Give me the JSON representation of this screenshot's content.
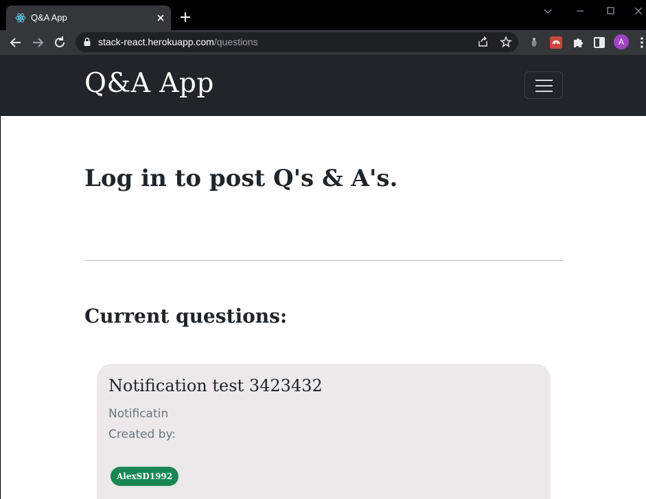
{
  "browser": {
    "tab": {
      "title": "Q&A App"
    },
    "address_bar": {
      "host": "stack-react.herokuapp.com",
      "path": "/questions"
    },
    "profile_initial": "A"
  },
  "navbar": {
    "brand": "Q&A App"
  },
  "main": {
    "login_prompt": "Log in to post Q's & A's.",
    "questions_heading": "Current questions:",
    "questions": [
      {
        "title": "Notification test 3423432",
        "body": "Notificatin",
        "created_by_label": "Created by:",
        "author": "AlexSD1992"
      }
    ]
  },
  "colors": {
    "navbar_bg": "#212529",
    "card_bg": "#ebe9ea",
    "badge_bg": "#198754"
  }
}
